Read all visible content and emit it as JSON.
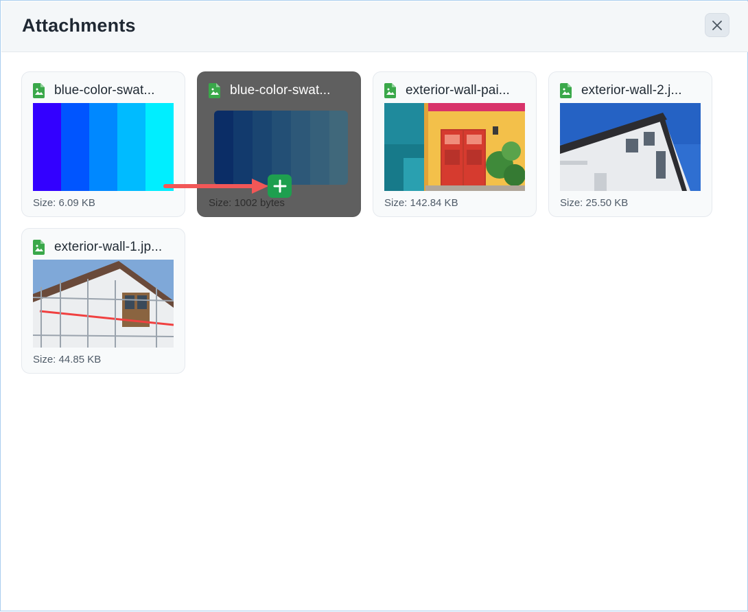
{
  "dialog": {
    "title": "Attachments",
    "close_icon": "close-icon"
  },
  "attachments": [
    {
      "name": "blue-color-swat...",
      "size": "Size: 6.09 KB",
      "icon": "image-file-icon"
    },
    {
      "name": "blue-color-swat...",
      "size": "Size: 1002 bytes",
      "icon": "image-file-icon",
      "state": "dragging"
    },
    {
      "name": "exterior-wall-pai...",
      "size": "Size: 142.84 KB",
      "icon": "image-file-icon"
    },
    {
      "name": "exterior-wall-2.j...",
      "size": "Size: 25.50 KB",
      "icon": "image-file-icon"
    },
    {
      "name": "exterior-wall-1.jp...",
      "size": "Size: 44.85 KB",
      "icon": "image-file-icon"
    }
  ],
  "drag_indicator": {
    "icon": "plus-icon",
    "arrow": "arrow-right-icon"
  },
  "colors": {
    "accent_green": "#1e9f4f",
    "arrow_red": "#f25757",
    "file_icon_green": "#3aa84a",
    "swatch_1": [
      "#3300ff",
      "#0055ff",
      "#0088ff",
      "#00bbff",
      "#00eeff"
    ],
    "swatch_2": [
      "#0b2d66",
      "#123a6d",
      "#1a4571",
      "#234f75",
      "#2d5878",
      "#36607a",
      "#40687b"
    ]
  }
}
